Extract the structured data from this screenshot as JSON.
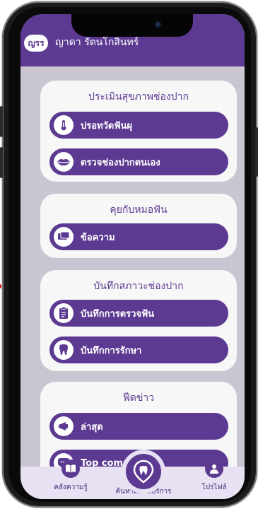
{
  "app": {
    "logo_text": "ญรร",
    "user_name": "ญาดา รัตนโกสินทร์"
  },
  "sections": [
    {
      "title": "ประเมินสุขภาพช่องปาก",
      "items": [
        {
          "label": "ปรอทวัดฟันผุ",
          "icon": "thermometer-icon"
        },
        {
          "label": "ตรวจช่องปากตนเอง",
          "icon": "lips-icon"
        }
      ]
    },
    {
      "title": "คุยกับหมอฟัน",
      "items": [
        {
          "label": "ข้อความ",
          "icon": "chat-messages-icon"
        }
      ]
    },
    {
      "title": "บันทึกสภาวะช่องปาก",
      "items": [
        {
          "label": "บันทึกการตรวจฟัน",
          "icon": "clipboard-icon"
        },
        {
          "label": "บันทึกการรักษา",
          "icon": "tooth-icon"
        }
      ]
    },
    {
      "title": "ฟีดข่าว",
      "items": [
        {
          "label": "ล่าสุด",
          "icon": "megaphone-icon"
        },
        {
          "label": "Top comm",
          "icon": "comment-icon"
        }
      ]
    }
  ],
  "bottom_nav": [
    {
      "label": "คลังความรู้",
      "icon": "book-icon"
    },
    {
      "label": "ค้นหาสถานบริการ",
      "icon": "map-pin-tooth-icon"
    },
    {
      "label": "โปรไฟล์",
      "icon": "profile-icon"
    }
  ],
  "colors": {
    "primary": "#5d3a91",
    "background": "#c9c6d2",
    "card": "#f7f7f7",
    "nav_bar": "#e7e1f3",
    "arrow": "#e0242b"
  }
}
